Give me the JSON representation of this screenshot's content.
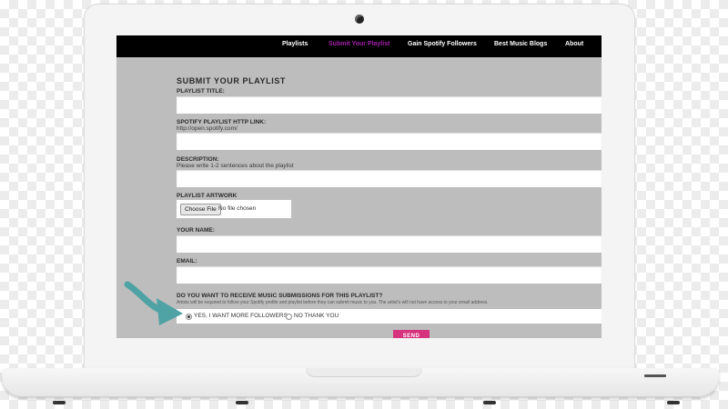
{
  "nav": {
    "items": [
      "Playlists",
      "Submit Your Playlist",
      "Gain Spotify Followers",
      "Best Music Blogs",
      "About"
    ],
    "active_index": 1,
    "active_color": "#a320a8"
  },
  "form": {
    "title": "SUBMIT YOUR PLAYLIST",
    "playlist_title_label": "PLAYLIST TITLE:",
    "spotify_link_label": "SPOTIFY PLAYLIST HTTP LINK:",
    "spotify_link_hint": "http://open.spotify.com/",
    "description_label": "DESCRIPTION:",
    "description_hint": "Please write 1-2 sentences about the playlist",
    "artwork_label": "PLAYLIST ARTWORK",
    "choose_file_label": "Choose File",
    "no_file_text": "No file chosen",
    "name_label": "YOUR NAME:",
    "email_label": "EMAIL:",
    "submissions_question": "DO YOU WANT TO RECEIVE MUSIC SUBMISSIONS FOR THIS PLAYLIST?",
    "submissions_note": "Artists will be required to follow your Spotify profile and playlist before they can submit music to you. The artist's will not have access to your email address.",
    "option_yes": "YES, I WANT MORE FOLLOWERS",
    "option_no": "NO THANK YOU",
    "selected_option": "yes",
    "send_label": "SEND",
    "send_color": "#d6317c"
  },
  "arrow_color": "#4fa3a5"
}
